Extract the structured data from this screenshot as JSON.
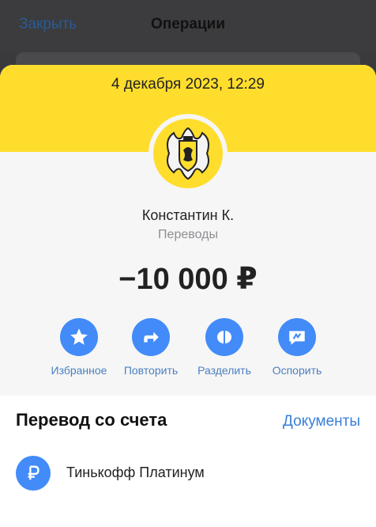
{
  "header": {
    "close_label": "Закрыть",
    "title": "Операции"
  },
  "operation": {
    "datetime": "4 декабря 2023, 12:29",
    "counterparty": "Константин К.",
    "category": "Переводы",
    "amount": "−10 000 ₽"
  },
  "actions": [
    {
      "label": "Избранное",
      "icon": "star-icon"
    },
    {
      "label": "Повторить",
      "icon": "repeat-arrow-icon"
    },
    {
      "label": "Разделить",
      "icon": "split-icon"
    },
    {
      "label": "Оспорить",
      "icon": "dispute-icon"
    }
  ],
  "details": {
    "heading": "Перевод со счета",
    "documents_label": "Документы",
    "account_name": "Тинькофф Платинум",
    "account_icon": "ruble-icon"
  },
  "colors": {
    "brand_yellow": "#ffdd2d",
    "action_blue": "#428bf9",
    "link_blue": "#3a7fd8"
  }
}
